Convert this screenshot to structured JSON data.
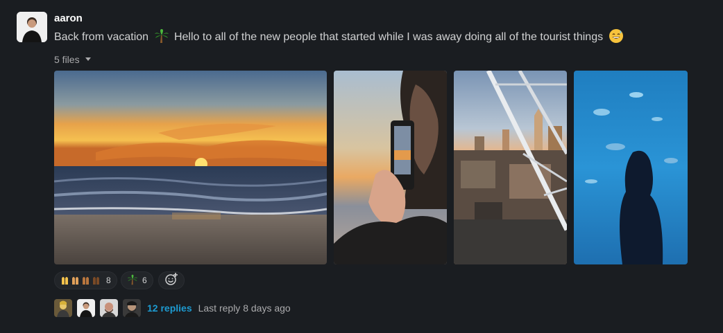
{
  "message": {
    "author": "aaron",
    "text_before_emoji": "Back from vacation",
    "text_after_emoji": "Hello to all of the new people that started while I was away doing all of the tourist things",
    "inline_emojis": [
      "palm-tree",
      "grinning-sweat"
    ]
  },
  "files": {
    "toggle_label": "5 files",
    "images": [
      {
        "name": "sunset-beach",
        "description_icon": "image"
      },
      {
        "name": "woman-photographing-sunset",
        "description_icon": "image"
      },
      {
        "name": "city-view-from-ferris-wheel",
        "description_icon": "image"
      },
      {
        "name": "aquarium-silhouette",
        "description_icon": "image"
      }
    ]
  },
  "reactions": [
    {
      "emoji": "raised-hands",
      "count": "8"
    },
    {
      "emoji": "palm-tree",
      "count": "6"
    }
  ],
  "thread": {
    "replies_label": "12 replies",
    "last_reply_label": "Last reply 8 days ago"
  },
  "colors": {
    "background": "#1a1d21",
    "link": "#1d9bd1",
    "text": "#d1d2d3",
    "muted": "#ababad"
  }
}
